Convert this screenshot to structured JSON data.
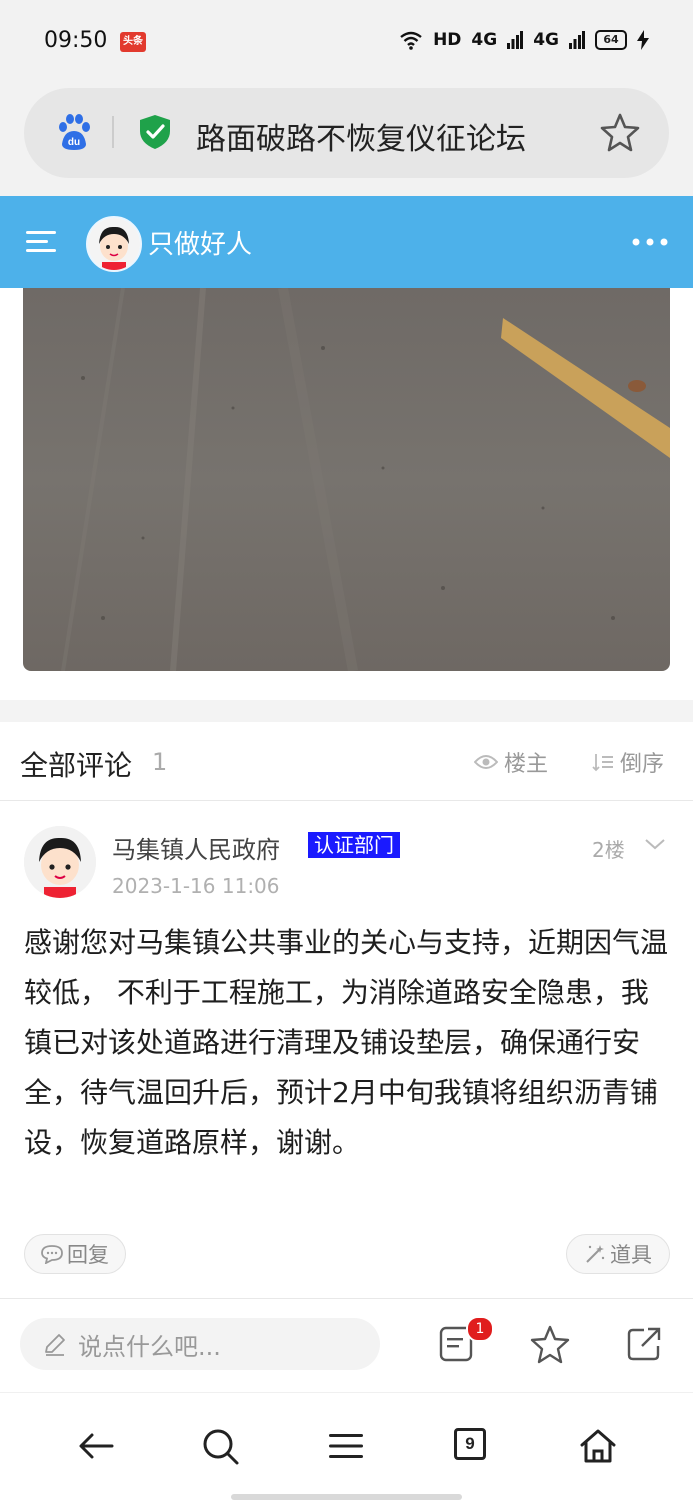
{
  "status_bar": {
    "time": "09:50",
    "app_icon_label": "头条",
    "hd": "HD",
    "signal1": "4G",
    "signal2": "4G",
    "battery": "64"
  },
  "browser": {
    "page_title": "路面破路不恢复仪征论坛",
    "tab_count": "9"
  },
  "forum_header": {
    "user_name": "只做好人"
  },
  "comments_section": {
    "title": "全部评论",
    "count": "1",
    "filter_owner": "楼主",
    "sort_label": "倒序"
  },
  "comment": {
    "author": "马集镇人民政府",
    "badge": "认证部门",
    "floor": "2楼",
    "timestamp": "2023-1-16 11:06",
    "body": "感谢您对马集镇公共事业的关心与支持，近期因气温较低， 不利于工程施工，为消除道路安全隐患，我镇已对该处道路进行清理及铺设垫层，确保通行安全，待气温回升后，预计2月中旬我镇将组织沥青铺设，恢复道路原样，谢谢。",
    "reply_label": "回复",
    "tools_label": "道具"
  },
  "bottom_bar": {
    "input_placeholder": "说点什么吧...",
    "comment_badge": "1"
  },
  "colors": {
    "forum_header_bg": "#4db1ea",
    "badge_bg": "#1a1aff",
    "notification_red": "#e01d1d",
    "shield_green": "#1fa24a"
  }
}
